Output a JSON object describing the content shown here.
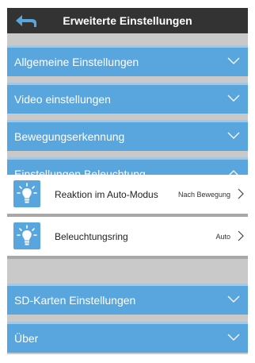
{
  "header": {
    "title": "Erweiterte Einstellungen"
  },
  "sections": [
    {
      "label": "Allgemeine Einstellungen",
      "state": "collapsed"
    },
    {
      "label": "Video einstellungen",
      "state": "collapsed"
    },
    {
      "label": "Bewegungserkennung",
      "state": "collapsed"
    },
    {
      "label": "Einstellungen Beleuchtung",
      "state": "expanded"
    },
    {
      "label": "SD-Karten Einstellungen",
      "state": "collapsed"
    },
    {
      "label": "Über",
      "state": "collapsed"
    }
  ],
  "lighting": {
    "items": [
      {
        "label": "Reaktion im Auto-Modus",
        "value": "Nach Bewegung",
        "icon": "lightbulb-icon"
      },
      {
        "label": "Beleuchtungsring",
        "value": "Auto",
        "icon": "lightbulb-icon"
      }
    ]
  },
  "colors": {
    "accent": "#59a6df",
    "header": "#333333"
  }
}
